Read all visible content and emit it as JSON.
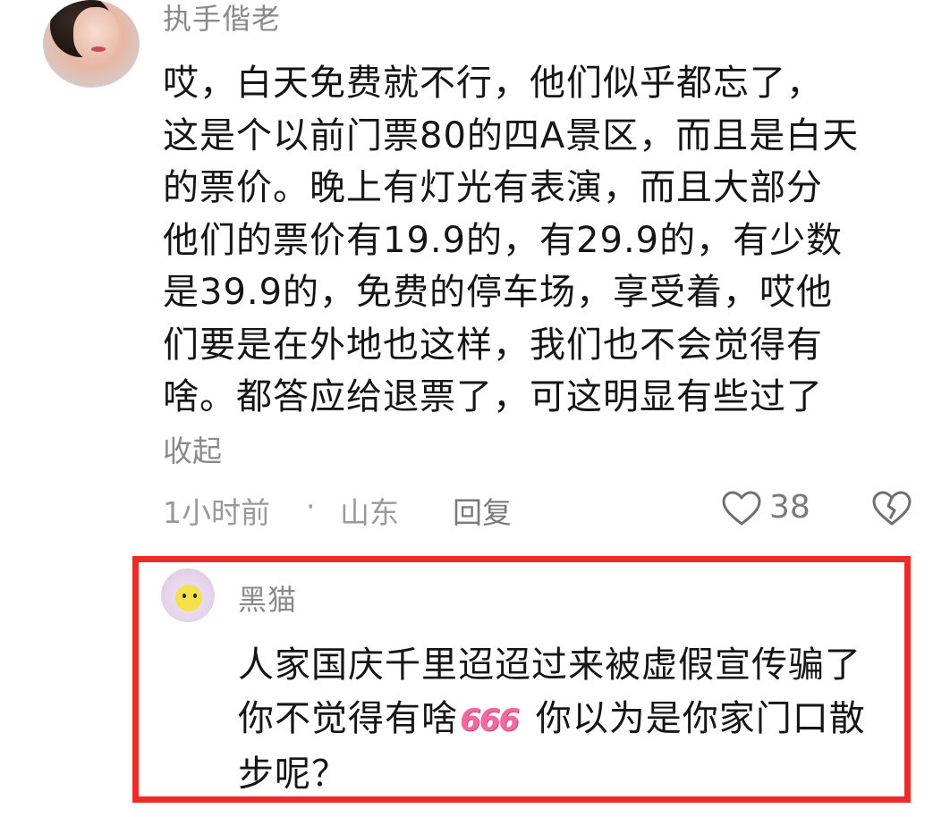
{
  "comment": {
    "username": "执手偕老",
    "lines": [
      "哎，白天免费就不行，他们似乎都忘了，",
      "这是个以前门票80的四A景区，而且是白天",
      "的票价。晚上有灯光有表演，而且大部分",
      "他们的票价有19.9的，有29.9的，有少数",
      "是39.9的，免费的停车场，享受着，哎他",
      "们要是在外地也这样，我们也不会觉得有",
      "啥。都答应给退票了，可这明显有些过了"
    ],
    "collapse_label": "收起",
    "time": "1小时前",
    "separator": "·",
    "location": "山东",
    "reply_label": "回复",
    "like_count": "38",
    "icons": {
      "like": "heart-outline-icon",
      "dislike": "broken-heart-icon"
    }
  },
  "reply": {
    "username": "黑猫",
    "line1": "人家国庆千里迢迢过来被虚假宣传骗了",
    "line2_before": "你不觉得有啥",
    "emoji": "666",
    "line2_after": " 你以为是你家门口散",
    "line3": "步呢？",
    "highlight_color": "#ee2a2a"
  }
}
